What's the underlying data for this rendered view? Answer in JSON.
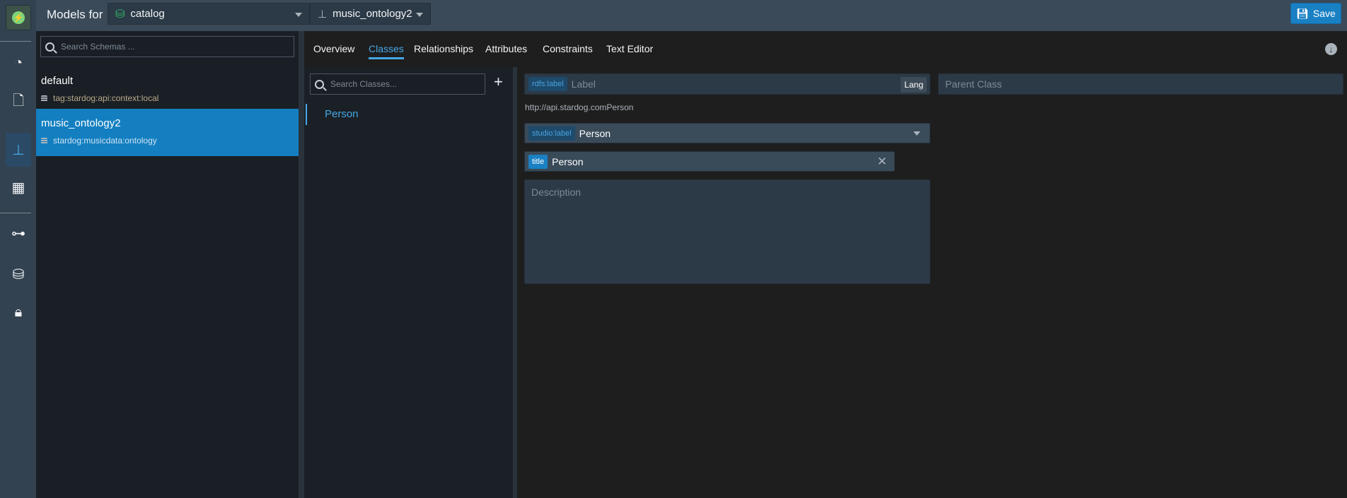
{
  "topbar": {
    "models_for": "Models for",
    "database": "catalog",
    "schema": "music_ontology2",
    "save": "Save"
  },
  "rail": {
    "icons": [
      "stardog-logo-icon",
      "dashboard-icon",
      "file-icon",
      "model-hierarchy-icon",
      "table-icon",
      "mapping-flow-icon",
      "database-icon",
      "lock-icon"
    ],
    "active": "model-hierarchy-icon"
  },
  "schemas": {
    "search_placeholder": "Search Schemas ...",
    "items": [
      {
        "name": "default",
        "graph": "tag:stardog:api:context:local"
      },
      {
        "name": "music_ontology2",
        "graph": "stardog:musicdata:ontology",
        "selected": true
      }
    ]
  },
  "tabs": [
    "Overview",
    "Classes",
    "Relationships",
    "Attributes",
    "Constraints",
    "Text Editor"
  ],
  "active_tab": "Classes",
  "classes": {
    "search_placeholder": "Search Classes...",
    "add": "+",
    "items": [
      "Person"
    ]
  },
  "form": {
    "label_chip": "rdfs:label",
    "label_placeholder": "Label",
    "lang": "Lang",
    "parent_placeholder": "Parent Class",
    "iri": "http://api.stardog.comPerson",
    "studio_chip": "studio:label",
    "studio_value": "Person",
    "title_chip": "title",
    "title_value": "Person",
    "description_placeholder": "Description"
  },
  "colors": {
    "accent": "#1a80c4",
    "link": "#45a7e6",
    "db_icon": "#2ebd6b"
  }
}
